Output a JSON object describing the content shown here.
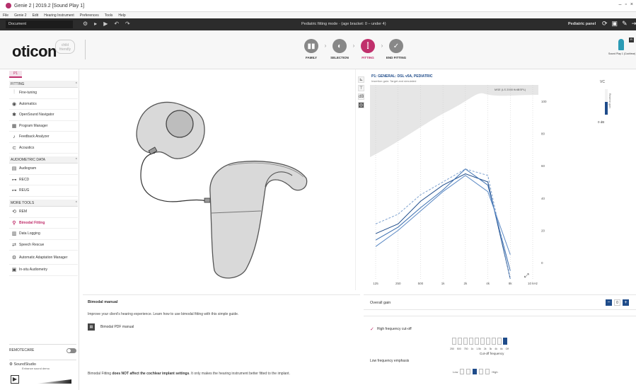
{
  "window": {
    "title": "Genie 2 | 2019.2 [Sound Play 1]",
    "controls": [
      "–",
      "▫",
      "×"
    ]
  },
  "menu": [
    "File",
    "Genie 2",
    "Edit",
    "Hearing Instrument",
    "Preferences",
    "Tools",
    "Help"
  ],
  "toolbar": {
    "session": "Document",
    "mode_text": "Pediatric fitting mode · (age bracket: 0 – under 4)",
    "pediatric_panel": "Pediatric panel"
  },
  "header": {
    "logo": "oticon",
    "logo_sub": "child friendly",
    "steps": [
      {
        "label": "FAMILY",
        "icon": "family-icon"
      },
      {
        "label": "SELECTION",
        "icon": "selection-icon"
      },
      {
        "label": "FITTING",
        "icon": "fitting-icon"
      },
      {
        "label": "END FITTING",
        "icon": "end-fitting-icon"
      }
    ],
    "active_step": "FITTING",
    "device_label": "Sound Play 1 (Cochlear)",
    "device_badge": "R"
  },
  "sidebar": {
    "tab": "P1",
    "sections": [
      {
        "title": "FITTING",
        "items": [
          "Fine-tuning",
          "Automatics",
          "OpenSound Navigator",
          "Program Manager",
          "Feedback Analyzer",
          "Acoustics"
        ]
      },
      {
        "title": "AUDIOMETRIC DATA",
        "items": [
          "Audiogram",
          "RECD",
          "REUG"
        ]
      },
      {
        "title": "MORE TOOLS",
        "items": [
          "REM",
          "Bimodal Fitting",
          "Data Logging",
          "Speech Rescue",
          "Automatic Adaptation Manager",
          "In-situ Audiometry"
        ]
      }
    ],
    "active_item": "Bimodal Fitting",
    "remotecare": "REMOTECARE",
    "soundstudio": {
      "title": "SoundStudio",
      "sub": "Enhance sound demo"
    }
  },
  "graph": {
    "title": "P1: GENERAL: DSL v5A, PEDIATRIC",
    "subtitle": "Insertion gain: Target and simulated",
    "legend": "MSE (LS 2000 ft/dBSPL)",
    "vc_label": "VC",
    "vc_side": "Reserve gain",
    "vc_db": "0 dB"
  },
  "chart_data": {
    "type": "line",
    "xlabel": "",
    "ylabel": "",
    "x": [
      "125",
      "250",
      "500",
      "1k",
      "2k",
      "4k",
      "8k",
      "10 kHz"
    ],
    "y_ticks": [
      0,
      20,
      40,
      60,
      80,
      100
    ],
    "ylim": [
      -10,
      110
    ],
    "series": [
      {
        "values": [
          18,
          24,
          38,
          48,
          55,
          50,
          -10
        ]
      },
      {
        "values": [
          14,
          22,
          34,
          45,
          58,
          48,
          -5
        ]
      },
      {
        "values": [
          10,
          20,
          32,
          44,
          54,
          44,
          5
        ]
      },
      {
        "values": [
          24,
          30,
          42,
          50,
          58,
          54,
          -10
        ]
      }
    ]
  },
  "bimodal": {
    "title": "Bimodal manual",
    "description": "Improve your client's hearing experience. Learn how to use bimodal fitting with this simple guide.",
    "pdf_label": "Bimodal PDF manual",
    "note_prefix": "Bimodal Fitting ",
    "note_bold": "does NOT affect the cochlear implant settings",
    "note_suffix": ". It only makes the hearing instrument better fitted to the implant."
  },
  "controls": {
    "overall_gain": "Overall gain",
    "gain_value": "0",
    "hf_cutoff": "High frequency cut-off",
    "cutoff_ticks": [
      "250",
      "500",
      "750",
      "1k",
      "1.5k",
      "2k",
      "3k",
      "4k",
      "6k",
      "Off"
    ],
    "cutoff_label": "Cut-off frequency",
    "lf_emphasis": "Low frequency emphasis",
    "lf_low": "Low",
    "lf_high": "High"
  }
}
